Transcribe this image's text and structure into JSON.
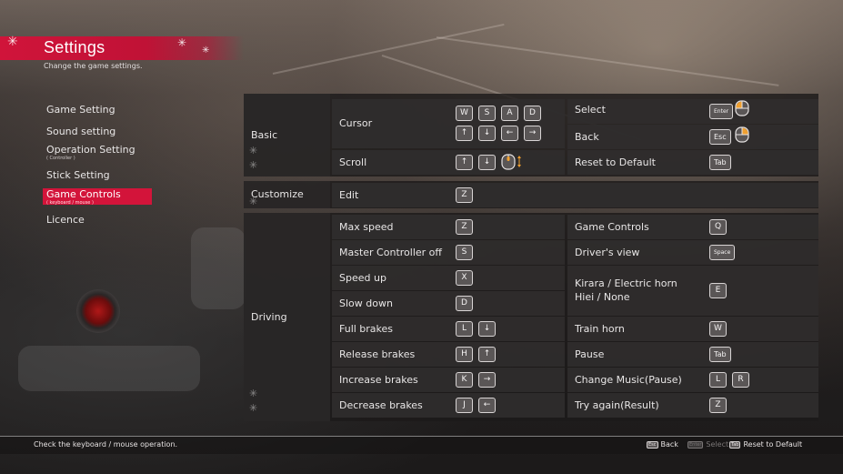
{
  "header": {
    "title": "Settings",
    "subtitle": "Change the game settings."
  },
  "menu": [
    {
      "label": "Game Setting",
      "sub": ""
    },
    {
      "label": "Sound setting",
      "sub": ""
    },
    {
      "label": "Operation Setting",
      "sub": "( Controller )"
    },
    {
      "label": "Stick Setting",
      "sub": ""
    },
    {
      "label": "Game Controls",
      "sub": "( keyboard / mouse )",
      "active": true
    },
    {
      "label": "Licence",
      "sub": ""
    }
  ],
  "sections": {
    "basic": {
      "name": "Basic",
      "left": [
        {
          "label": "Cursor",
          "keys": [
            "W",
            "S",
            "A",
            "D",
            "↑",
            "↓",
            "←",
            "→"
          ]
        },
        {
          "label": "Scroll",
          "keys": [
            "↑",
            "↓"
          ],
          "mouse": "mouse-wheel-icon"
        }
      ],
      "right": [
        {
          "label": "Select",
          "keys": [
            "Enter"
          ],
          "mouse": "mouse-left-click-icon"
        },
        {
          "label": "Back",
          "keys": [
            "Esc"
          ],
          "mouse": "mouse-right-click-icon"
        },
        {
          "label": "Reset to Default",
          "keys": [
            "Tab"
          ]
        }
      ]
    },
    "customize": {
      "name": "Customize",
      "rows": [
        {
          "label": "Edit",
          "keys": [
            "Z"
          ]
        }
      ]
    },
    "driving": {
      "name": "Driving",
      "left": [
        {
          "label": "Max speed",
          "keys": [
            "Z"
          ]
        },
        {
          "label": "Master Controller off",
          "keys": [
            "S"
          ]
        },
        {
          "label": "Speed up",
          "keys": [
            "X"
          ]
        },
        {
          "label": "Slow down",
          "keys": [
            "D"
          ]
        },
        {
          "label": "Full brakes",
          "keys": [
            "L",
            "↓"
          ]
        },
        {
          "label": "Release brakes",
          "keys": [
            "H",
            "↑"
          ]
        },
        {
          "label": "Increase brakes",
          "keys": [
            "K",
            "→"
          ]
        },
        {
          "label": "Decrease brakes",
          "keys": [
            "J",
            "←"
          ]
        }
      ],
      "right": [
        {
          "label": "Game Controls",
          "keys": [
            "Q"
          ]
        },
        {
          "label": "Driver's view",
          "keys": [
            "Space"
          ]
        },
        {
          "label": "Kirara / Electric horn",
          "label2": "Hiei / None",
          "keys": [
            "E"
          ]
        },
        {
          "label": "Train horn",
          "keys": [
            "W"
          ]
        },
        {
          "label": "Pause",
          "keys": [
            "Tab"
          ]
        },
        {
          "label": "Change Music(Pause)",
          "keys": [
            "L",
            "R"
          ]
        },
        {
          "label": "Try again(Result)",
          "keys": [
            "Z"
          ]
        }
      ]
    }
  },
  "footer": {
    "help": "Check the keyboard / mouse operation.",
    "actions": [
      {
        "key": "Esc",
        "label": "Back",
        "enabled": true
      },
      {
        "key": "Enter",
        "label": "Select",
        "enabled": false
      },
      {
        "key": "Tab",
        "label": "Reset to Default",
        "enabled": true
      }
    ]
  },
  "colors": {
    "accent": "#d3143a",
    "panel": "#302e2e",
    "mouse_highlight": "#f0a030"
  }
}
